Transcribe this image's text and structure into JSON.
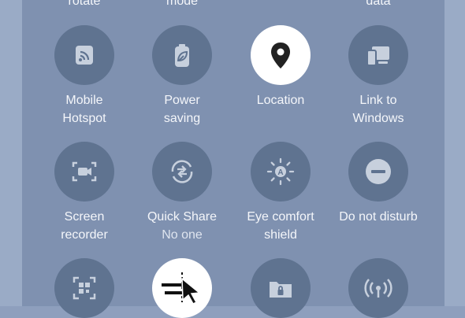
{
  "top_row_labels": [
    "rotate",
    "mode",
    "data"
  ],
  "tiles": [
    {
      "label1": "Mobile",
      "label2": "Hotspot",
      "icon": "hotspot-icon",
      "active": false
    },
    {
      "label1": "Power",
      "label2": "saving",
      "icon": "power-saving-icon",
      "active": false
    },
    {
      "label1": "Location",
      "label2": "",
      "icon": "location-pin-icon",
      "active": true
    },
    {
      "label1": "Link to",
      "label2": "Windows",
      "icon": "link-to-windows-icon",
      "active": false
    },
    {
      "label1": "Screen",
      "label2": "recorder",
      "icon": "screen-recorder-icon",
      "active": false
    },
    {
      "label1": "Quick Share",
      "label2": "No one",
      "icon": "quick-share-icon",
      "active": false
    },
    {
      "label1": "Eye comfort",
      "label2": "shield",
      "icon": "eye-comfort-icon",
      "active": false
    },
    {
      "label1": "Do not disturb",
      "label2": "",
      "icon": "do-not-disturb-icon",
      "active": false
    }
  ],
  "bottom_row_icons": [
    "qr-scanner-icon",
    "pointer-icon",
    "secure-folder-icon",
    "nearby-icon"
  ],
  "colors": {
    "tile_inactive": "#5f7390",
    "tile_active": "#ffffff",
    "panel": "#7f91b0",
    "text": "#f4f6fa"
  }
}
